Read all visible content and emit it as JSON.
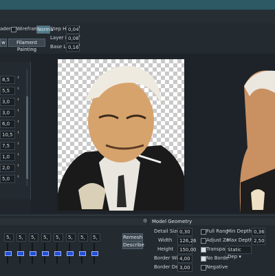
{
  "toolbar": {
    "shader_label": "ader",
    "wireframe_label": "Wireframe",
    "norma_label": "Norma",
    "step_height_label": "Step He",
    "step_height_value": "0,04",
    "layer_height_label": "Layer H",
    "layer_height_value": "0,08",
    "base_layer_label": "Base Li",
    "base_layer_value": "0,16",
    "left_btn_label": "w",
    "filament_button_label": "Filament Painting"
  },
  "left_values": [
    "8,5",
    "5,5",
    "3,0",
    "3,0",
    "6,0",
    "10,5",
    "7,5",
    "1,0",
    "2,0",
    "5,0"
  ],
  "bottom_left": {
    "sliders": [
      "5,",
      "5,",
      "5,",
      "5,",
      "5,",
      "5,",
      "5,",
      "5,"
    ],
    "remesh_label": "Remesh",
    "describe_label": "Describe"
  },
  "model_geometry": {
    "title": "Model Geometry",
    "detail_size_label": "Detail Size",
    "detail_size_value": "0,30",
    "width_label": "Width",
    "width_value": "126,26",
    "height_label": "Height",
    "height_value": "150,00",
    "border_width_label": "Border Wid",
    "border_width_value": "4,00",
    "border_depth_label": "Border Dep",
    "border_depth_value": "3,00",
    "full_range_label": "Full Rang",
    "adjust_label": "Adjust Ze",
    "transparent_label": "Transpare",
    "no_border_label": "No Borde",
    "negative_label": "Negative",
    "min_depth_label": "Min Depth",
    "min_depth_value": "0,36",
    "max_depth_label": "Max Depth",
    "max_depth_value": "2,50",
    "static_label": "Static Dep"
  },
  "colors": {
    "titlebar": "#2c5964",
    "panel": "#232a30",
    "canvas": "#1d2328"
  }
}
